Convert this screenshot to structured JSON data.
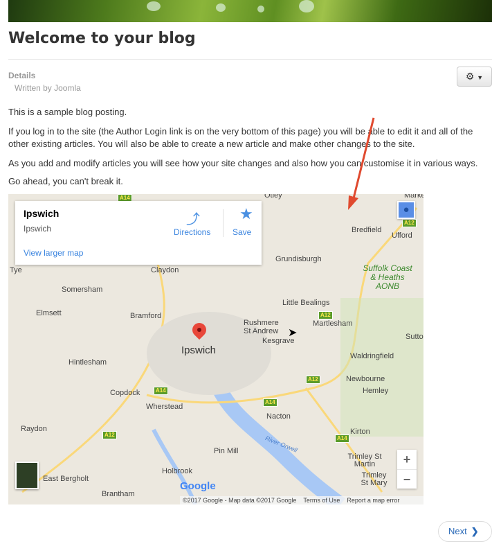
{
  "article": {
    "title": "Welcome to your blog",
    "details_label": "Details",
    "author": "Written by Joomla",
    "paragraphs": [
      "This is a sample blog posting.",
      "If you log in to the site (the Author Login link is on the very bottom of this page) you will be able to edit it and all of the other existing articles. You will also be able to create a new article and make other changes to the site.",
      "As you add and modify articles you will see how your site changes and also how you can customise it in various ways.",
      "Go ahead, you can't break it."
    ],
    "tools_icon": "gear-icon"
  },
  "map": {
    "card": {
      "title": "Ipswich",
      "subtitle": "Ipswich",
      "view_larger": "View larger map",
      "directions": "Directions",
      "save": "Save"
    },
    "places": [
      "Otley",
      "Bredfield",
      "Ufford",
      "Grundisburgh",
      "Claydon",
      "Somersham",
      "Elmsett",
      "Bramford",
      "Little Bealings",
      "Rushmere St Andrew",
      "Martlesham",
      "Kesgrave",
      "Sutto",
      "Hintlesham",
      "Waldringfield",
      "Newbourne",
      "Hemley",
      "Copdock",
      "Wherstead",
      "Nacton",
      "Raydon",
      "Kirton",
      "Pin Mill",
      "Trimley St Martin",
      "Trimley St Mary",
      "Holbrook",
      "East Bergholt",
      "Brantham",
      "Marke",
      "Tye"
    ],
    "main_place": "Ipswich",
    "aonb": "Suffolk Coast & Heaths AONB",
    "river": "River Orwell",
    "roads": [
      "A14",
      "A12",
      "A14",
      "A12",
      "A14",
      "A12",
      "A14",
      "A12"
    ],
    "zoom_in": "+",
    "zoom_out": "−",
    "logo": "Google",
    "attribution": "©2017 Google - Map data ©2017 Google",
    "terms": "Terms of Use",
    "report": "Report a map error",
    "annotation_color": "#e04a2f"
  },
  "pagination": {
    "next": "Next"
  }
}
